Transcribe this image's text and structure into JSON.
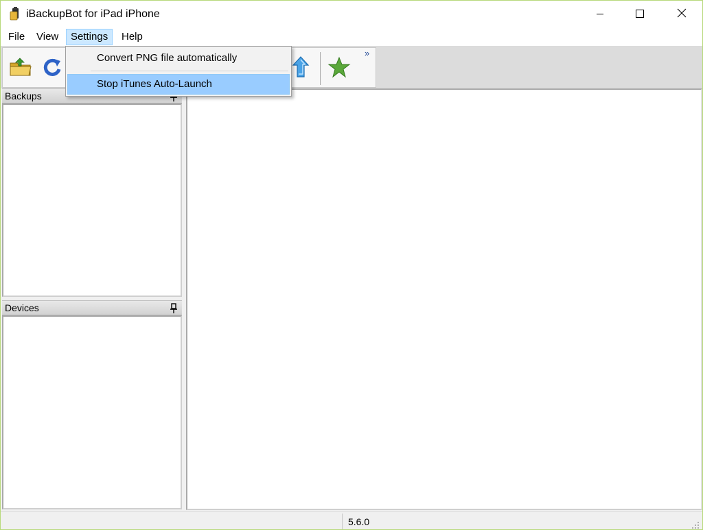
{
  "window": {
    "title": "iBackupBot for iPad iPhone",
    "controls": {
      "minimize": "minimize-icon",
      "maximize": "maximize-icon",
      "close": "close-icon"
    }
  },
  "menubar": {
    "items": [
      {
        "label": "File"
      },
      {
        "label": "View"
      },
      {
        "label": "Settings",
        "state": "open"
      },
      {
        "label": "Help"
      }
    ]
  },
  "toolbar": {
    "buttons": [
      {
        "icon": "open-folder-icon"
      },
      {
        "icon": "refresh-icon"
      },
      {
        "icon": "upload-arrow-icon"
      },
      {
        "icon": "star-icon"
      }
    ],
    "overflow": "»"
  },
  "settings_menu": {
    "items": [
      {
        "label": "Convert PNG file automatically"
      },
      {
        "label": "Stop iTunes Auto-Launch",
        "highlighted": true
      }
    ]
  },
  "panels": {
    "backups": {
      "title": "Backups"
    },
    "devices": {
      "title": "Devices"
    }
  },
  "statusbar": {
    "version": "5.6.0"
  },
  "colors": {
    "menu_highlight": "#99ccff",
    "window_border": "#b7d97a",
    "star": "#5aa83a"
  }
}
